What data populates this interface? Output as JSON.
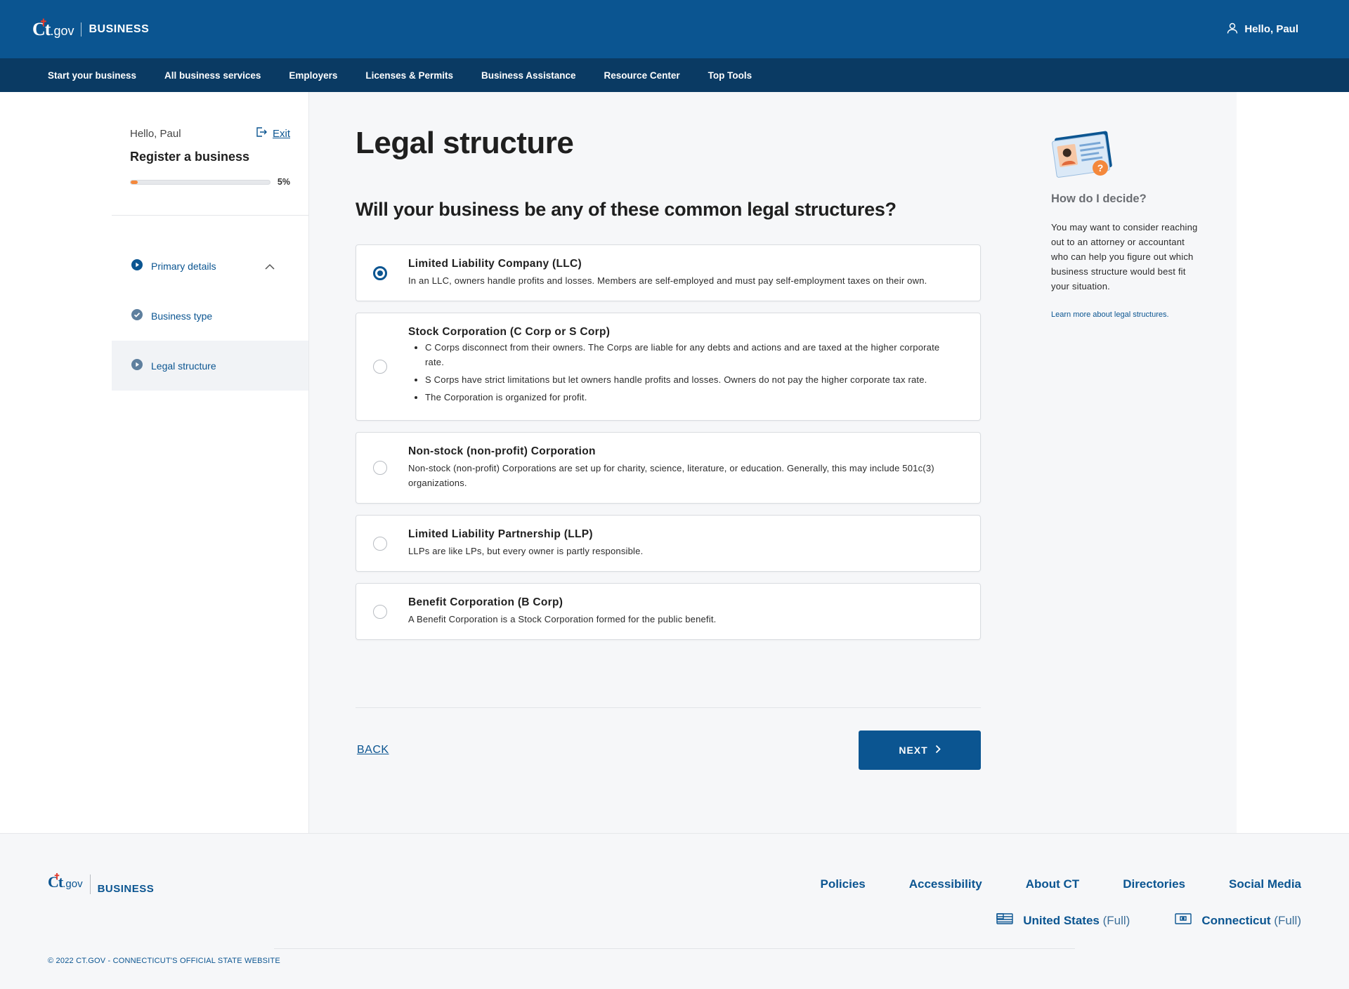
{
  "header": {
    "logo": "Ct.gov",
    "section": "BUSINESS",
    "greeting": "Hello, Paul"
  },
  "nav": {
    "items": [
      "Start your business",
      "All business services",
      "Employers",
      "Licenses & Permits",
      "Business Assistance",
      "Resource Center",
      "Top Tools"
    ]
  },
  "sidebar": {
    "hello": "Hello, Paul",
    "exit": "Exit",
    "title": "Register a business",
    "progress_percent": 5,
    "progress_label": "5%",
    "steps": [
      {
        "label": "Primary details",
        "icon": "play-circle-icon",
        "expanded": true
      },
      {
        "label": "Business type",
        "icon": "check-circle-icon"
      },
      {
        "label": "Legal structure",
        "icon": "play-circle-icon",
        "active": true
      }
    ]
  },
  "main": {
    "title": "Legal structure",
    "question": "Will your business be any of these common legal structures?",
    "options": [
      {
        "title": "Limited Liability Company (LLC)",
        "desc": "In an LLC, owners handle profits and losses. Members are self-employed and must pay self-employment taxes on their own.",
        "selected": true
      },
      {
        "title": "Stock Corporation (C Corp or S Corp)",
        "bullets": [
          "C Corps disconnect from their owners. The Corps are liable for any debts and actions and are taxed at the higher corporate rate.",
          "S Corps have strict limitations but let owners handle profits and losses. Owners do not pay the higher corporate tax rate.",
          "The Corporation is organized for profit."
        ],
        "selected": false
      },
      {
        "title": "Non-stock (non-profit) Corporation",
        "desc": "Non-stock (non-profit) Corporations are set up for charity, science, literature, or education. Generally, this may include 501c(3) organizations.",
        "selected": false
      },
      {
        "title": "Limited Liability Partnership (LLP)",
        "desc": "LLPs are like LPs, but every owner is partly responsible.",
        "selected": false
      },
      {
        "title": "Benefit Corporation (B Corp)",
        "desc": "A Benefit Corporation is a Stock Corporation formed for the public benefit.",
        "selected": false
      }
    ],
    "back_label": "BACK",
    "next_label": "NEXT"
  },
  "help": {
    "title": "How do I decide?",
    "body": "You may want to consider reaching out to an attorney or accountant who can help you figure out which business structure would best fit your situation.",
    "link": "Learn more about legal structures."
  },
  "footer": {
    "logo": "Ct.gov",
    "section": "BUSINESS",
    "links": [
      "Policies",
      "Accessibility",
      "About CT",
      "Directories",
      "Social Media"
    ],
    "sites": [
      {
        "name": "United States",
        "suffix": "(Full)",
        "icon": "us-flag-icon"
      },
      {
        "name": "Connecticut",
        "suffix": "(Full)",
        "icon": "ct-state-icon"
      }
    ],
    "copyright": "© 2022 CT.GOV - CONNECTICUT'S OFFICIAL STATE WEBSITE"
  },
  "colors": {
    "primary": "#0b5591",
    "nav_dark": "#0a3a63",
    "progress": "#f4883c",
    "background": "#f6f7f9"
  }
}
